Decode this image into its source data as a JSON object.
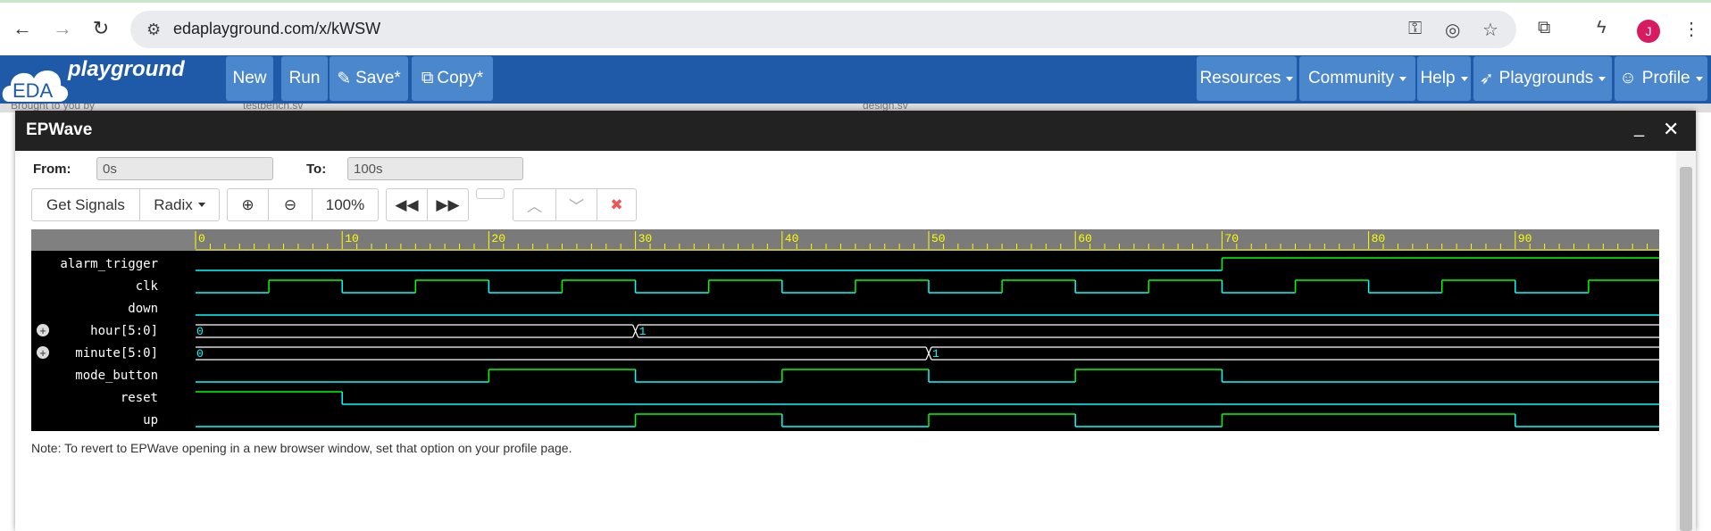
{
  "browser": {
    "url": "edaplayground.com/x/kWSW",
    "avatar_letter": "J"
  },
  "navbar": {
    "logo_eda": "EDA",
    "logo_playground": "playground",
    "buttons": [
      "New",
      "Run",
      "Save*",
      "Copy*"
    ],
    "menus": [
      "Resources",
      "Community",
      "Help",
      "Playgrounds",
      "Profile"
    ]
  },
  "behind_tabs": [
    "Brought to you by",
    "testbench.sv",
    "design.sv"
  ],
  "dialog": {
    "title": "EPWave",
    "from_label": "From:",
    "from_value": "0s",
    "to_label": "To:",
    "to_value": "100s",
    "get_signals": "Get Signals",
    "radix": "Radix",
    "zoom": "100%",
    "note": "Note: To revert to EPWave opening in a new browser window, set that option on your profile page."
  },
  "waveform": {
    "time_ticks": [
      "0",
      "10",
      "20",
      "30",
      "40",
      "50",
      "60",
      "70",
      "80",
      "90"
    ],
    "signals": [
      {
        "name": "alarm_trigger",
        "type": "bit",
        "transitions": [
          [
            0,
            0
          ],
          [
            70,
            1
          ]
        ]
      },
      {
        "name": "clk",
        "type": "bit",
        "transitions": [
          [
            0,
            0
          ],
          [
            5,
            1
          ],
          [
            10,
            0
          ],
          [
            15,
            1
          ],
          [
            20,
            0
          ],
          [
            25,
            1
          ],
          [
            30,
            0
          ],
          [
            35,
            1
          ],
          [
            40,
            0
          ],
          [
            45,
            1
          ],
          [
            50,
            0
          ],
          [
            55,
            1
          ],
          [
            60,
            0
          ],
          [
            65,
            1
          ],
          [
            70,
            0
          ],
          [
            75,
            1
          ],
          [
            80,
            0
          ],
          [
            85,
            1
          ],
          [
            90,
            0
          ],
          [
            95,
            1
          ]
        ]
      },
      {
        "name": "down",
        "type": "bit",
        "transitions": [
          [
            0,
            0
          ]
        ]
      },
      {
        "name": "hour[5:0]",
        "type": "bus",
        "values": [
          [
            0,
            "0"
          ],
          [
            30,
            "1"
          ]
        ]
      },
      {
        "name": "minute[5:0]",
        "type": "bus",
        "values": [
          [
            0,
            "0"
          ],
          [
            50,
            "1"
          ]
        ]
      },
      {
        "name": "mode_button",
        "type": "bit",
        "transitions": [
          [
            0,
            0
          ],
          [
            20,
            1
          ],
          [
            30,
            0
          ],
          [
            40,
            1
          ],
          [
            50,
            0
          ],
          [
            60,
            1
          ],
          [
            70,
            0
          ]
        ]
      },
      {
        "name": "reset",
        "type": "bit",
        "transitions": [
          [
            0,
            1
          ],
          [
            10,
            0
          ]
        ]
      },
      {
        "name": "up",
        "type": "bit",
        "transitions": [
          [
            0,
            0
          ],
          [
            30,
            1
          ],
          [
            40,
            0
          ],
          [
            50,
            1
          ],
          [
            60,
            0
          ],
          [
            70,
            1
          ],
          [
            90,
            0
          ]
        ]
      }
    ],
    "colors": {
      "bg": "#000000",
      "ruler": "#808080",
      "tick": "#ffff00",
      "high": "#00ff00",
      "low": "#00ffff",
      "bus": "#ffffff",
      "busText": "#00ffff"
    }
  }
}
